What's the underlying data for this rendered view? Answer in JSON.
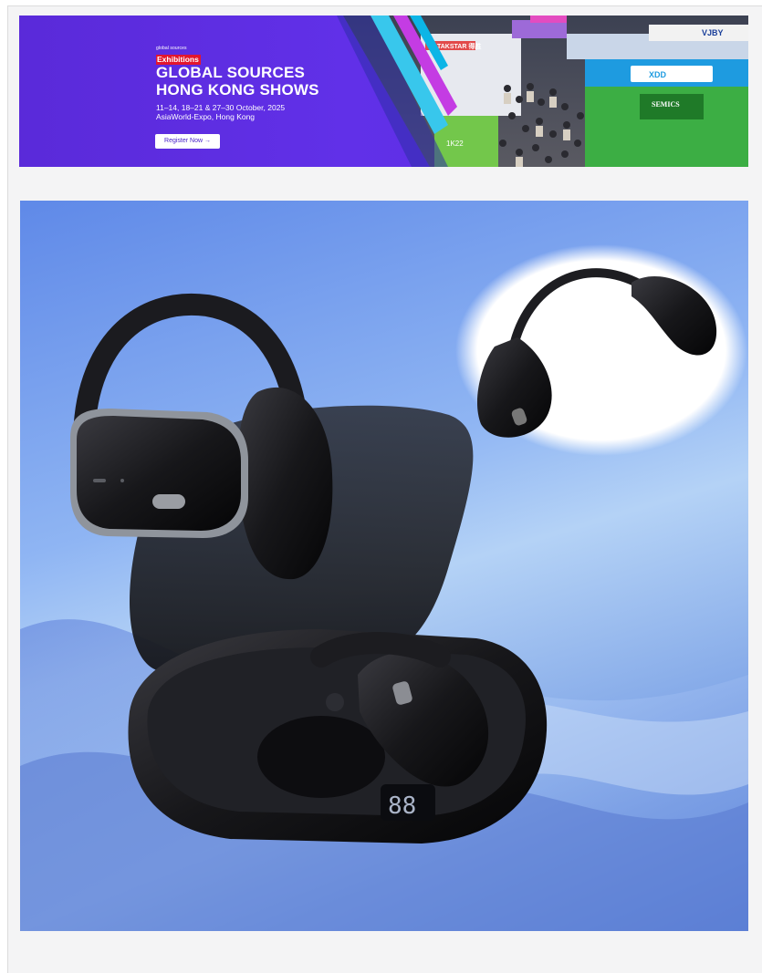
{
  "banner": {
    "brand_small": "global sources",
    "brand_exhibitions": "Exhibitions",
    "headline_line1": "GLOBAL SOURCES",
    "headline_line2": "HONG KONG SHOWS",
    "dates": "11–14, 18–21 & 27–30 October, 2025",
    "venue": "AsiaWorld-Expo, Hong Kong",
    "register_label": "Register Now",
    "register_arrow": "→",
    "booth_signs": [
      "TAKSTAR 得胜",
      "VJBY",
      "XDD",
      "SEMICS",
      "1K22"
    ]
  },
  "product": {
    "image_subject": "open-ear headphones with charging case",
    "case_display": "88"
  },
  "colors": {
    "banner_purple": "#5b2be0",
    "register_text": "#4a22c9",
    "product_bg_top": "#5d86e6",
    "product_bg_bottom": "#a9c9f4"
  }
}
